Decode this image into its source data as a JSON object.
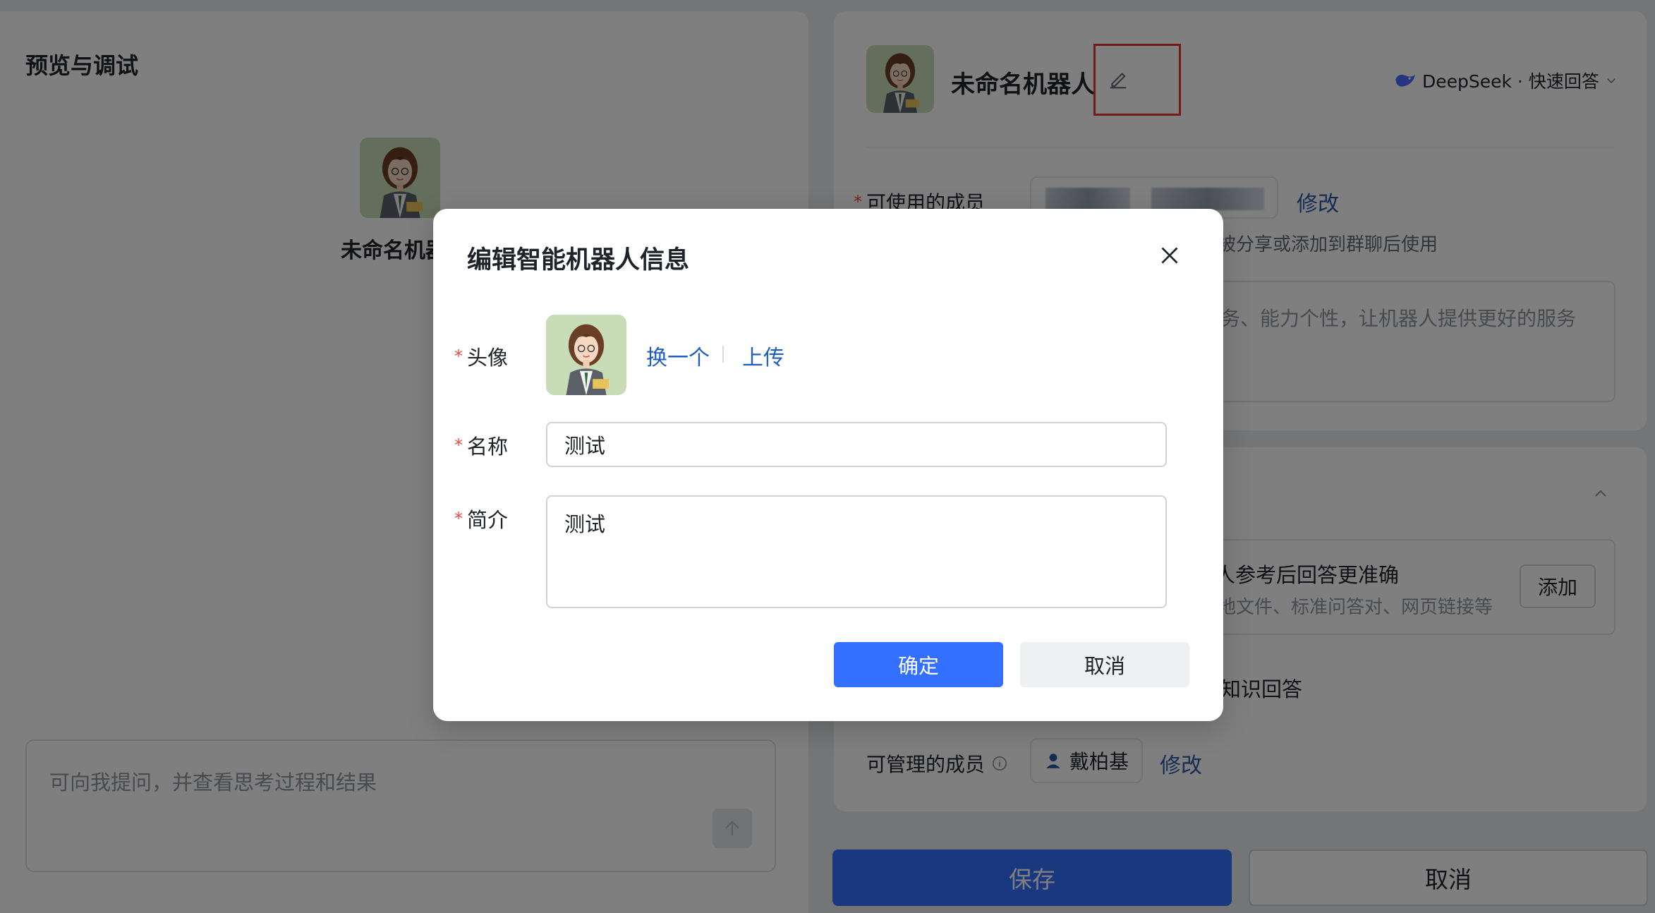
{
  "preview": {
    "title": "预览与调试",
    "bot_name": "未命名机器",
    "input_placeholder": "可向我提问，并查看思考过程和结果"
  },
  "config": {
    "bot_name": "未命名机器人",
    "model_label": "DeepSeek · 快速回答",
    "members": {
      "label": "可使用的成员",
      "edit_link": "修改",
      "hint": "被分享或添加到群聊后使用"
    },
    "intro_placeholder": "务、能力个性，让机器人提供更好的服务",
    "knowledge": {
      "title": "人参考后回答更准确",
      "subtitle": "地文件、标准问答对、网页链接等",
      "add_button": "添加"
    },
    "knowledge_answer_text": "知识回答",
    "admins": {
      "label": "可管理的成员",
      "member_name": "戴柏基",
      "edit_link": "修改"
    }
  },
  "footer": {
    "save_label": "保存",
    "cancel_label": "取消"
  },
  "modal": {
    "title": "编辑智能机器人信息",
    "avatar_label": "头像",
    "swap_link": "换一个",
    "upload_link": "上传",
    "name_label": "名称",
    "name_value": "测试",
    "intro_label": "简介",
    "intro_value": "测试",
    "required_mark": "*",
    "confirm_label": "确定",
    "cancel_label": "取消"
  },
  "colors": {
    "primary": "#3370ff",
    "link": "#1f5fbf",
    "required": "#f54a45",
    "highlight": "#e53935"
  }
}
